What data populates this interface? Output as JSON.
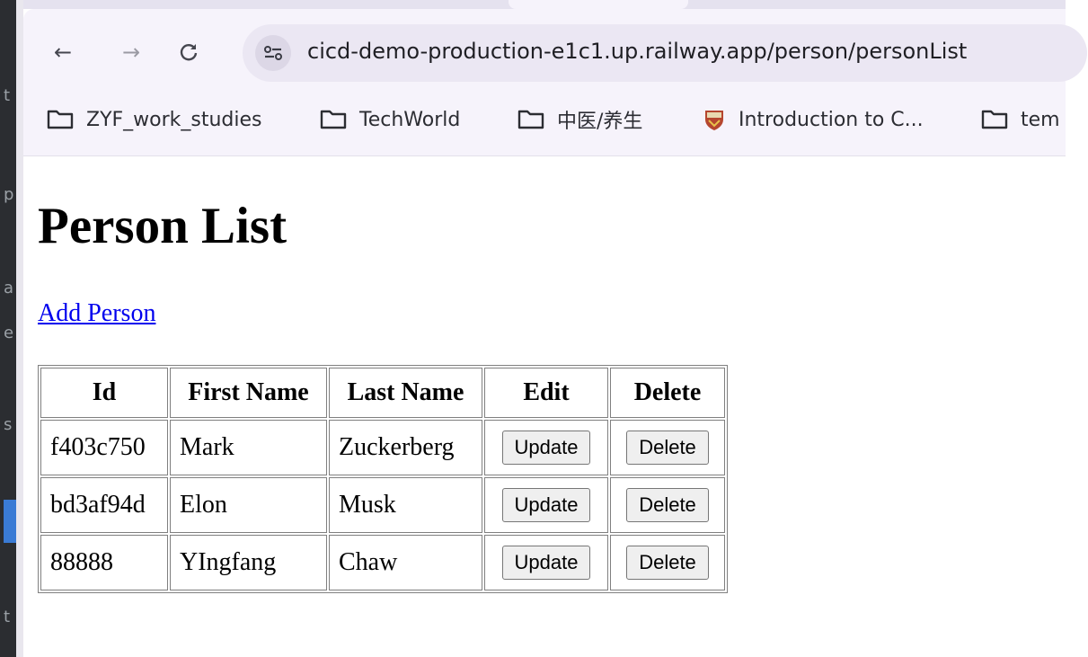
{
  "browser": {
    "url": "cicd-demo-production-e1c1.up.railway.app/person/personList",
    "bookmarks": [
      {
        "label": "ZYF_work_studies",
        "icon": "folder-icon"
      },
      {
        "label": "TechWorld",
        "icon": "folder-icon"
      },
      {
        "label": "中医/养生",
        "icon": "folder-icon"
      },
      {
        "label": "Introduction to C...",
        "icon": "shield-icon"
      },
      {
        "label": "tem",
        "icon": "folder-icon"
      }
    ]
  },
  "page": {
    "title": "Person List",
    "add_link": "Add Person",
    "columns": [
      "Id",
      "First Name",
      "Last Name",
      "Edit",
      "Delete"
    ],
    "rows": [
      {
        "id": "f403c750",
        "first": "Mark",
        "last": "Zuckerberg",
        "edit": "Update",
        "delete": "Delete"
      },
      {
        "id": "bd3af94d",
        "first": "Elon",
        "last": "Musk",
        "edit": "Update",
        "delete": "Delete"
      },
      {
        "id": "88888",
        "first": "YIngfang",
        "last": "Chaw",
        "edit": "Update",
        "delete": "Delete"
      }
    ]
  },
  "colors": {
    "link": "#0000ee",
    "chrome_bg": "#f6f3fb",
    "omnibox_bg": "#ebe7f3"
  }
}
